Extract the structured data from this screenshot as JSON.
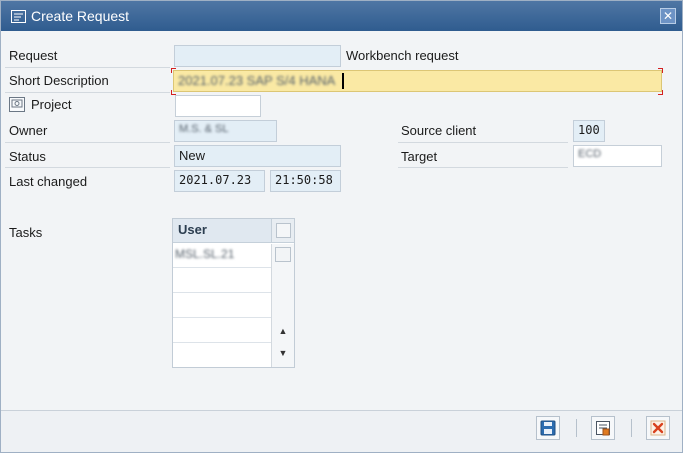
{
  "window": {
    "title": "Create Request",
    "icon": "request-create-icon",
    "close_icon": "close-icon"
  },
  "form": {
    "request": {
      "label": "Request",
      "value": "",
      "type_text": "Workbench request"
    },
    "short_description": {
      "label": "Short Description",
      "value": "2021.07.23 SAP S/4 HANA"
    },
    "project": {
      "label": "Project",
      "icon": "project-icon",
      "value": ""
    },
    "owner": {
      "label": "Owner",
      "value": "M.S. & SL"
    },
    "status": {
      "label": "Status",
      "value": "New"
    },
    "last_changed": {
      "label": "Last changed",
      "date": "2021.07.23",
      "time": "21:50:58"
    },
    "source_client": {
      "label": "Source client",
      "value": "100"
    },
    "target": {
      "label": "Target",
      "value": "ECD"
    }
  },
  "tasks": {
    "label": "Tasks",
    "column_header": "User",
    "rows": [
      "MSL.SL.21",
      "",
      "",
      "",
      ""
    ],
    "scroll_up_icon": "scroll-up-icon",
    "scroll_down_icon": "scroll-down-icon"
  },
  "toolbar": {
    "save_icon": "save-icon",
    "local_request_icon": "local-request-icon",
    "cancel_icon": "cancel-icon"
  },
  "colors": {
    "titlebar": "#2f5c8f",
    "required_field": "#fae9a4",
    "readonly_field": "#e3eef6",
    "cancel_red": "#d9421f"
  }
}
